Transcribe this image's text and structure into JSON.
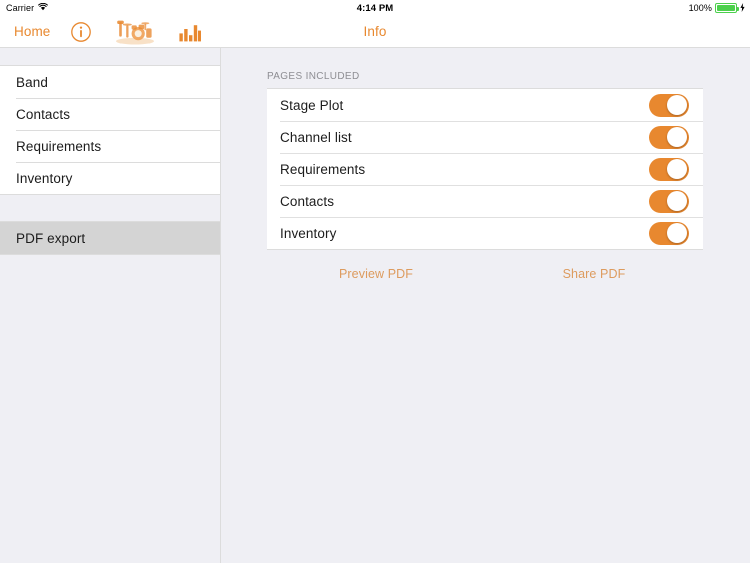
{
  "status_bar": {
    "carrier": "Carrier",
    "wifi_icon": "wifi-icon",
    "time": "4:14 PM",
    "battery_percent": "100%",
    "battery_icon": "battery-full-charging-icon",
    "battery_color": "#4cd04c"
  },
  "nav_bar": {
    "back_label": "Home",
    "title": "Info",
    "accent_color": "#e8882f",
    "icons": [
      {
        "name": "info-circle-icon",
        "label": "Info"
      },
      {
        "name": "drum-kit-stage-icon",
        "label": "Stage"
      },
      {
        "name": "bar-chart-icon",
        "label": "Channels"
      }
    ]
  },
  "sidebar": {
    "items": [
      {
        "label": "Band",
        "selected": false
      },
      {
        "label": "Contacts",
        "selected": false
      },
      {
        "label": "Requirements",
        "selected": false
      },
      {
        "label": "Inventory",
        "selected": false
      }
    ],
    "secondary_items": [
      {
        "label": "PDF export",
        "selected": true
      }
    ],
    "selected_background": "#d4d4d4"
  },
  "main": {
    "section_header": "PAGES INCLUDED",
    "rows": [
      {
        "label": "Stage Plot",
        "toggle_on": true
      },
      {
        "label": "Channel list",
        "toggle_on": true
      },
      {
        "label": "Requirements",
        "toggle_on": true
      },
      {
        "label": "Contacts",
        "toggle_on": true
      },
      {
        "label": "Inventory",
        "toggle_on": true
      }
    ],
    "toggle_on_color": "#e8882f",
    "actions": [
      {
        "label": "Preview PDF"
      },
      {
        "label": "Share PDF"
      }
    ],
    "action_color": "#dd9b5e"
  }
}
